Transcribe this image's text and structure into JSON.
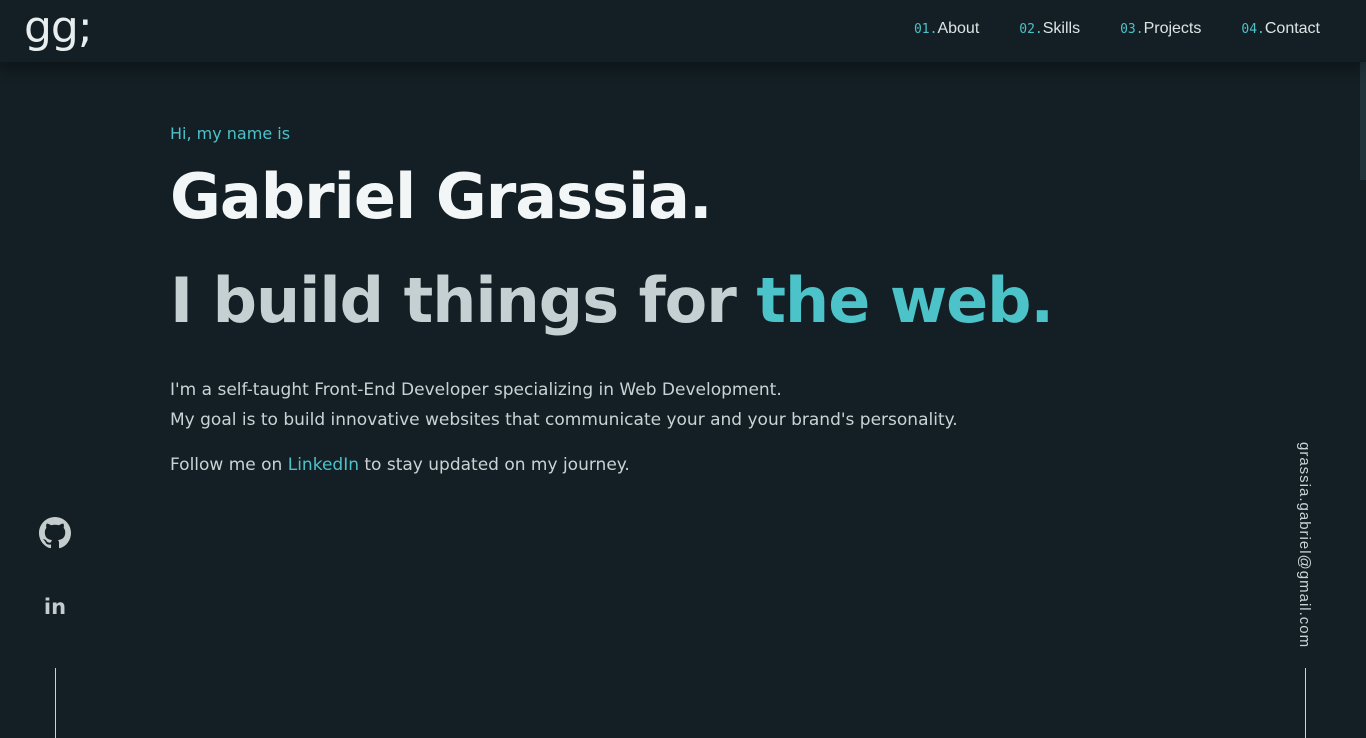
{
  "header": {
    "logo": "gg;",
    "nav": [
      {
        "num": "01.",
        "label": "About"
      },
      {
        "num": "02.",
        "label": "Skills"
      },
      {
        "num": "03.",
        "label": "Projects"
      },
      {
        "num": "04.",
        "label": "Contact"
      }
    ]
  },
  "hero": {
    "greeting": "Hi, my name is",
    "name": "Gabriel Grassia.",
    "tagline_prefix": "I build things for ",
    "tagline_accent": "the web.",
    "description_line1": "I'm a self-taught Front-End Developer specializing in Web Development.",
    "description_line2": "My goal is to build innovative websites that communicate your and your brand's personality.",
    "follow_prefix": "Follow me on ",
    "follow_link": "LinkedIn",
    "follow_suffix": " to stay updated on my journey."
  },
  "social": {
    "github_icon": "github-icon",
    "linkedin_icon": "linkedin-icon",
    "linkedin_text": "in"
  },
  "email": "grassia.gabriel@gmail.com",
  "colors": {
    "background": "#131f24",
    "accent": "#4cc2c9",
    "heading": "#f2f6f7",
    "text": "#c9d3d6"
  }
}
